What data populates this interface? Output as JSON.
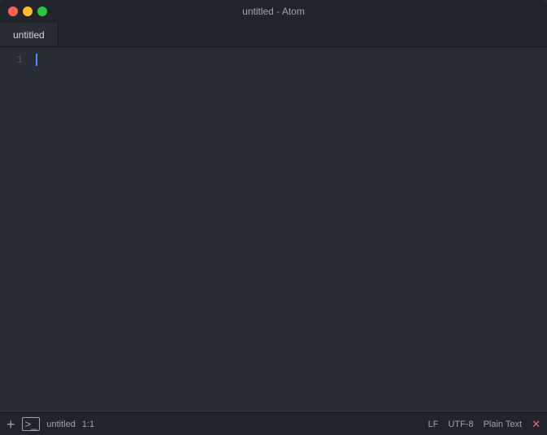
{
  "window": {
    "title": "untitled - Atom"
  },
  "tab": {
    "label": "untitled"
  },
  "gutter": {
    "line_numbers": [
      "1"
    ]
  },
  "status_bar": {
    "left": {
      "add_label": "+",
      "terminal_label": ">_",
      "filename": "untitled",
      "position": "1:1"
    },
    "right": {
      "line_ending": "LF",
      "encoding": "UTF-8",
      "syntax": "Plain Text",
      "error_icon": "✕"
    }
  },
  "traffic_lights": {
    "close_color": "#ff5f57",
    "minimize_color": "#febc2e",
    "maximize_color": "#28c840"
  }
}
